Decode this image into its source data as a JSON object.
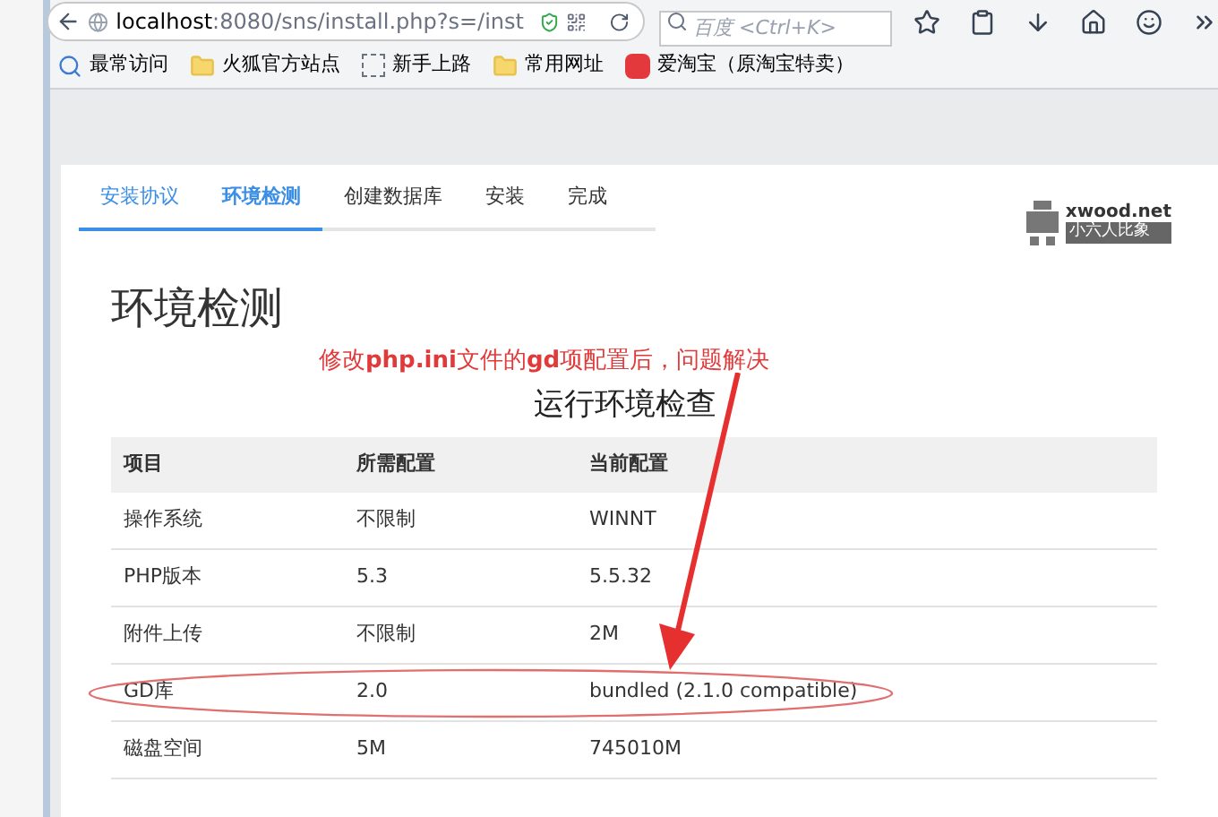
{
  "browser": {
    "url_host": "localhost",
    "url_rest": ":8080/sns/install.php?s=/inst",
    "search_placeholder": "百度 <Ctrl+K>",
    "bookmarks": [
      {
        "label": "最常访问",
        "kind": "search"
      },
      {
        "label": "火狐官方站点",
        "kind": "folder"
      },
      {
        "label": "新手上路",
        "kind": "page"
      },
      {
        "label": "常用网址",
        "kind": "folder"
      },
      {
        "label": "爱淘宝（原淘宝特卖）",
        "kind": "taobao"
      }
    ]
  },
  "tabs": [
    {
      "label": "安装协议",
      "selected": false,
      "done": true
    },
    {
      "label": "环境检测",
      "selected": true,
      "done": true
    },
    {
      "label": "创建数据库",
      "selected": false,
      "done": false
    },
    {
      "label": "安装",
      "selected": false,
      "done": false
    },
    {
      "label": "完成",
      "selected": false,
      "done": false
    }
  ],
  "logo": {
    "name": "xwood.net",
    "tagline": "小六人比象"
  },
  "heading": "环境检测",
  "annotation": "修改**php.ini**文件的**gd**项配置后，问题解决",
  "table": {
    "title": "运行环境检查",
    "columns": [
      "项目",
      "所需配置",
      "当前配置"
    ],
    "rows": [
      {
        "cells": [
          "操作系统",
          "不限制",
          "WINNT"
        ],
        "circled": false
      },
      {
        "cells": [
          "PHP版本",
          "5.3",
          "5.5.32"
        ],
        "circled": false
      },
      {
        "cells": [
          "附件上传",
          "不限制",
          "2M"
        ],
        "circled": false
      },
      {
        "cells": [
          "GD库",
          "2.0",
          "bundled (2.1.0 compatible)"
        ],
        "circled": true
      },
      {
        "cells": [
          "磁盘空间",
          "5M",
          "745010M"
        ],
        "circled": false
      }
    ]
  }
}
